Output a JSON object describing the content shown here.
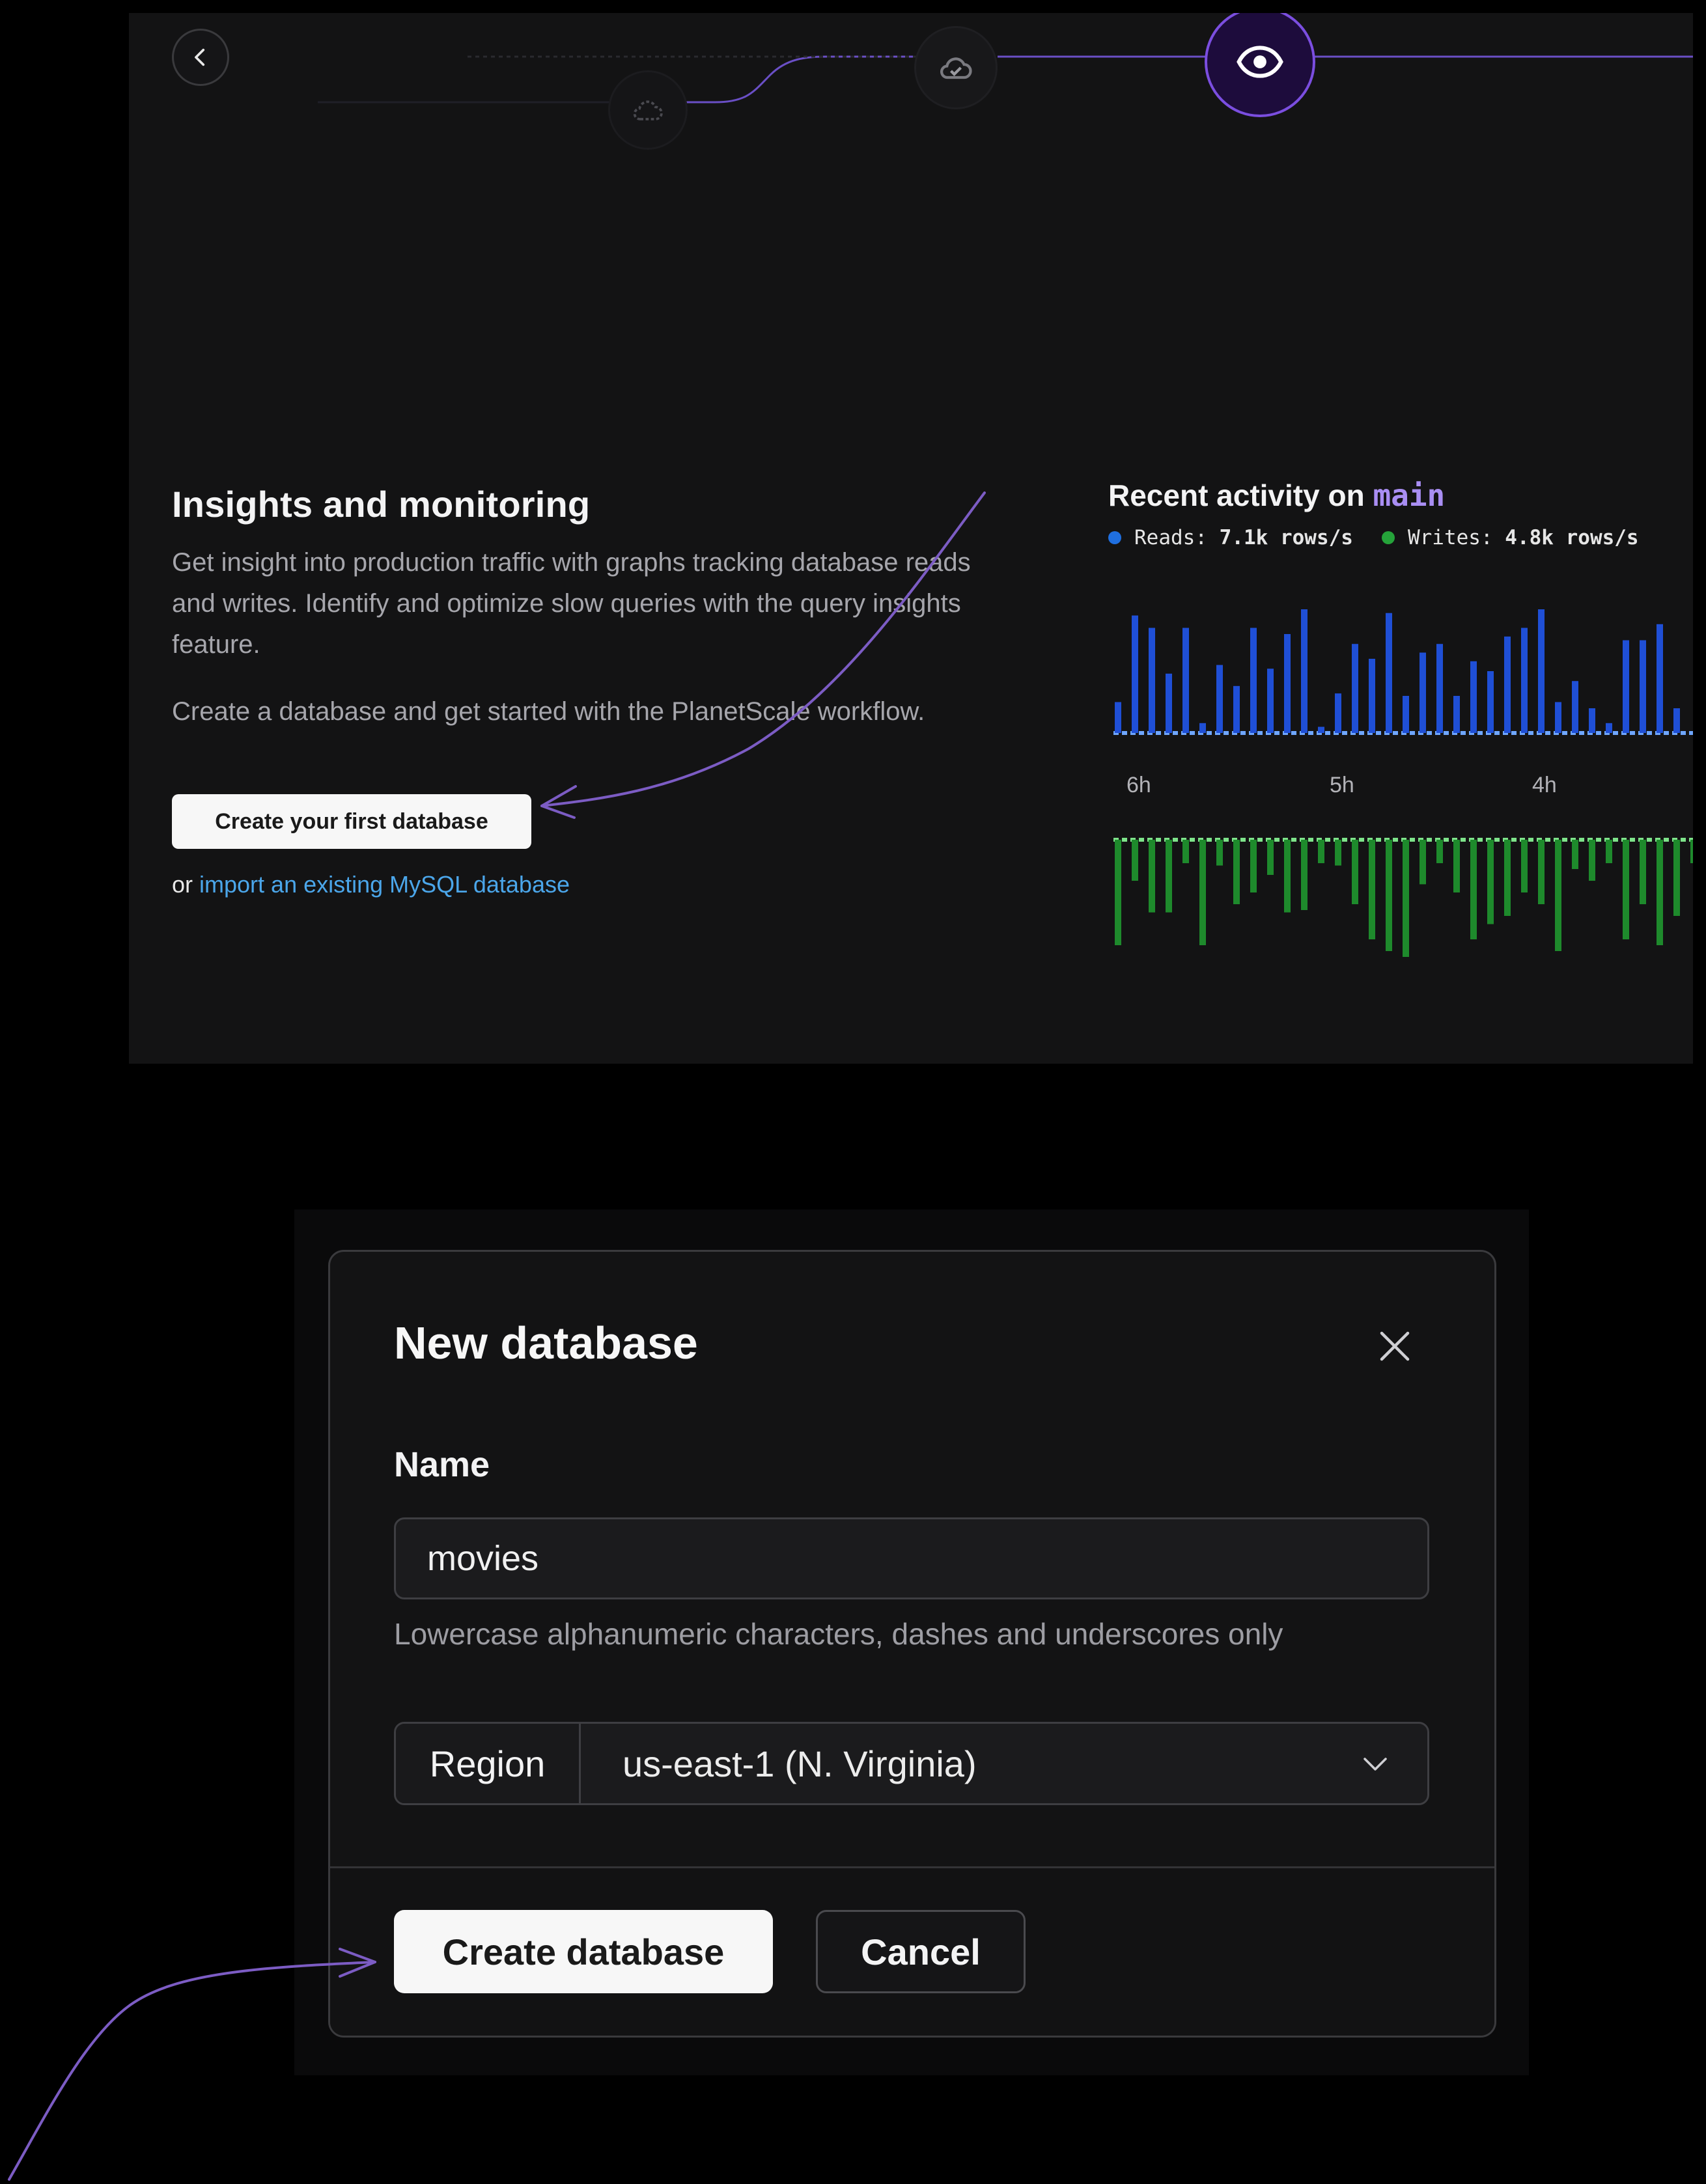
{
  "top_panel": {
    "insights": {
      "title": "Insights and monitoring",
      "description": "Get insight into production traffic with graphs tracking database reads and writes. Identify and optimize slow queries with the query insights feature.",
      "cta_text": "Create a database and get started with the PlanetScale workflow.",
      "first_db_button": "Create your first database",
      "import_prefix": "or",
      "import_link": "import an existing MySQL database"
    },
    "activity": {
      "title_prefix": "Recent activity on",
      "branch": "main",
      "reads_label": "Reads:",
      "reads_value": "7.1k rows/s",
      "writes_label": "Writes:",
      "writes_value": "4.8k rows/s"
    }
  },
  "chart_data": {
    "type": "bar",
    "time_labels": [
      "6h",
      "5h",
      "4h"
    ],
    "reads_values": [
      0.25,
      0.95,
      0.85,
      0.48,
      0.85,
      0.08,
      0.55,
      0.38,
      0.85,
      0.52,
      0.8,
      1.0,
      0.05,
      0.32,
      0.72,
      0.6,
      0.97,
      0.3,
      0.65,
      0.72,
      0.3,
      0.58,
      0.5,
      0.78,
      0.85,
      1.0,
      0.25,
      0.42,
      0.2,
      0.08,
      0.75,
      0.75,
      0.88,
      0.2
    ],
    "writes_values": [
      0.9,
      0.35,
      0.62,
      0.62,
      0.2,
      0.9,
      0.22,
      0.55,
      0.45,
      0.3,
      0.62,
      0.6,
      0.2,
      0.22,
      0.55,
      0.85,
      0.95,
      1.0,
      0.38,
      0.2,
      0.45,
      0.85,
      0.72,
      0.65,
      0.45,
      0.55,
      0.95,
      0.25,
      0.35,
      0.2,
      0.85,
      0.55,
      0.9,
      0.65,
      0.2
    ],
    "colors": {
      "reads": "#1f4fd6",
      "writes": "#1e8a2c",
      "reads_dot": "#1f6fe0",
      "writes_dot": "#25a33a"
    }
  },
  "modal": {
    "title": "New database",
    "name_label": "Name",
    "name_value": "movies",
    "hint": "Lowercase alphanumeric characters, dashes and underscores only",
    "region_label": "Region",
    "region_value": "us-east-1 (N. Virginia)",
    "create_button": "Create database",
    "cancel_button": "Cancel"
  },
  "icons": {
    "back": "chevron-left-icon",
    "cloud": "cloud-icon",
    "cloud_check": "cloud-check-icon",
    "eye": "eye-icon",
    "close": "close-icon",
    "dropdown": "chevron-down-icon"
  },
  "colors": {
    "accent": "#7b4ee0",
    "link": "#4ba6ea",
    "branch": "#a98ef3",
    "annotation_arrow": "#7c5cc4"
  }
}
